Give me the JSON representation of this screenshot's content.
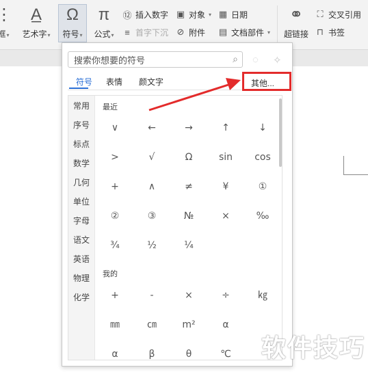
{
  "ribbon": {
    "frame_label": "框",
    "wordart_label": "艺术字",
    "symbol_label": "符号",
    "formula_label": "公式",
    "insert_number_label": "插入数字",
    "first_letter_label": "首字下沉",
    "object_label": "对象",
    "attachment_label": "附件",
    "date_label": "日期",
    "docpart_label": "文档部件",
    "hyperlink_label": "超链接",
    "crossref_label": "交叉引用",
    "bookmark_label": "书签"
  },
  "dialog": {
    "search_placeholder": "搜索你想要的符号",
    "tabs": [
      "符号",
      "表情",
      "颜文字"
    ],
    "active_tab": "符号",
    "other_label": "其他...",
    "categories": [
      "常用",
      "序号",
      "标点",
      "数学",
      "几何",
      "单位",
      "字母",
      "语文",
      "英语",
      "物理",
      "化学"
    ],
    "section_recent": "最近",
    "section_mine": "我的",
    "recent_symbols": [
      [
        "∨",
        "←",
        "→",
        "↑",
        "↓"
      ],
      [
        ">",
        "√",
        "Ω",
        "sin",
        "cos"
      ],
      [
        "+",
        "∧",
        "≠",
        "¥",
        "①"
      ],
      [
        "②",
        "③",
        "№",
        "×",
        "‰"
      ],
      [
        "¾",
        "½",
        "¼"
      ]
    ],
    "my_symbols": [
      [
        "+",
        "-",
        "×",
        "÷",
        "㎏"
      ],
      [
        "㎜",
        "㎝",
        "m²",
        "α",
        ""
      ],
      [
        "α",
        "β",
        "θ",
        "℃",
        ""
      ]
    ]
  },
  "annotation": {
    "color": "#e32b2b"
  },
  "watermark": "软件技巧"
}
